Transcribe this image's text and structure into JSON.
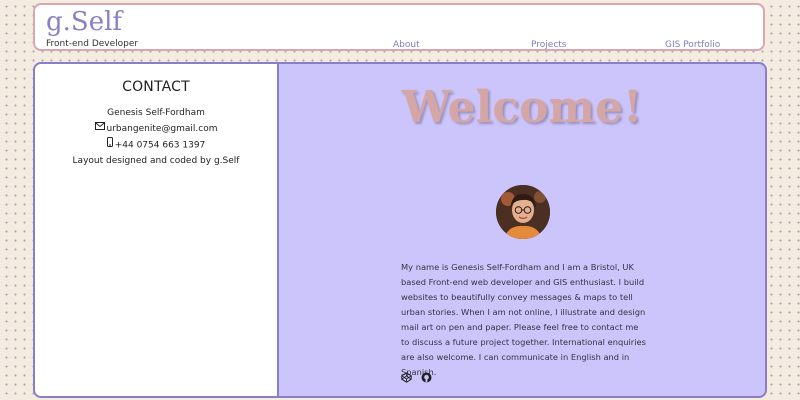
{
  "header": {
    "logo": "g.Self",
    "tagline": "Front-end Developer",
    "nav": [
      "About",
      "Projects",
      "GIS Portfolio"
    ]
  },
  "sidebar": {
    "heading": "CONTACT",
    "name": "Genesis Self-Fordham",
    "email": "urbangenite@gmail.com",
    "phone": "+44 0754 663 1397",
    "credit": "Layout designed and coded by g.Self"
  },
  "main": {
    "welcome": "Welcome!",
    "bio": "My name is Genesis Self-Fordham and I am a Bristol, UK based Front-end web developer and GIS enthusiast. I build websites to beautifully convey messages & maps to tell urban stories. When I am not online, I illustrate and design mail art on pen and paper. Please feel free to contact me to discuss a future project together. International enquiries are also welcome. I can communicate in English and in Spanish."
  },
  "icons": {
    "email": "envelope-icon",
    "phone": "mobile-phone-icon",
    "social": [
      "codepen-icon",
      "github-icon"
    ]
  },
  "colors": {
    "brand": "#8a7fc6",
    "main_background": "#ccc5fb",
    "welcome_text": "#d4a7a6",
    "header_border": "#d7a9ae"
  }
}
